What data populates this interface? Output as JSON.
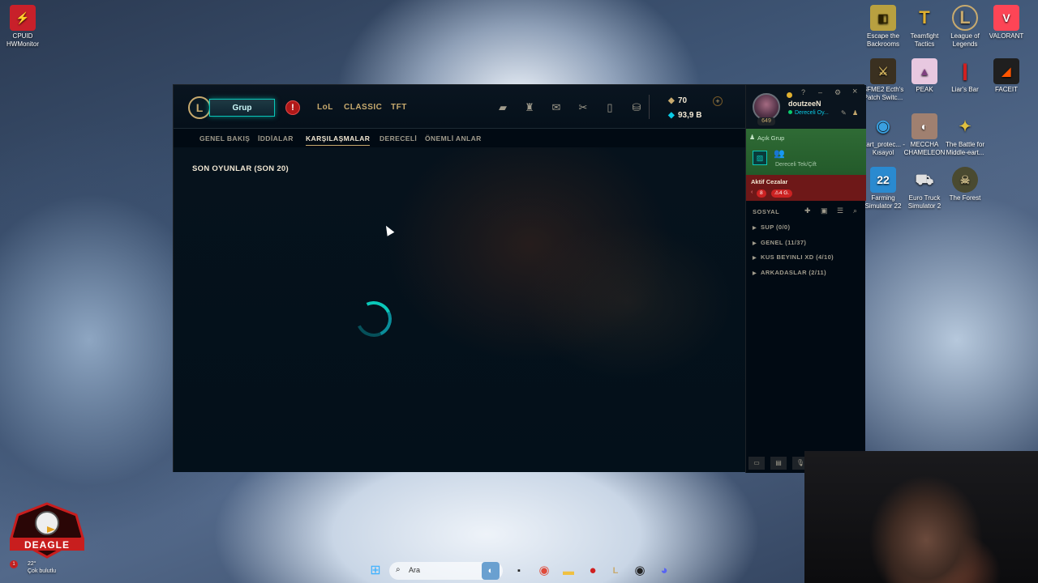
{
  "desktop": {
    "left_icons": [
      {
        "label": "CPUID HWMonitor"
      }
    ],
    "right_icons": [
      {
        "label": "Escape the Backrooms"
      },
      {
        "label": "Teamfight Tactics"
      },
      {
        "label": "League of Legends"
      },
      {
        "label": "VALORANT"
      },
      {
        "label": "BFME2 Ecth's Patch Switc..."
      },
      {
        "label": "PEAK"
      },
      {
        "label": "Liar's Bar"
      },
      {
        "label": "FACEIT"
      },
      {
        "label": "start_protec... - Kısayol"
      },
      {
        "label": "MECCHA CHAMELEON"
      },
      {
        "label": "The Battle for Middle-eart..."
      },
      {
        "label": "Farming Simulator 22"
      },
      {
        "label": "Euro Truck Simulator 2"
      },
      {
        "label": "The Forest"
      }
    ],
    "deagle_logo": "DEAGLE"
  },
  "client": {
    "play_button": "Grup",
    "alert": "!",
    "modes": [
      "LoL",
      "CLASSIC",
      "TFT"
    ],
    "currency": {
      "rp": "70",
      "be": "93,9 B",
      "plus": "+"
    },
    "profile": {
      "username": "doutzeeN",
      "status": "Dereceli Oy...",
      "level": "649"
    },
    "window_controls": {
      "help": "?",
      "minimize": "–",
      "settings": "⚙",
      "close": "×"
    },
    "subnav": [
      "GENEL BAKIŞ",
      "İDDİALAR",
      "KARŞILAŞMALAR",
      "DERECELİ",
      "ÖNEMLİ ANLAR"
    ],
    "section_title": "SON OYUNLAR (SON 20)",
    "party": {
      "label": "Açık Grup",
      "queue": "Dereceli Tek/Çift"
    },
    "penalty": {
      "title": "Aktif Cezalar",
      "count": "8",
      "duration": "4 G."
    },
    "social": {
      "title": "SOSYAL",
      "groups": [
        "SUP (0/0)",
        "GENEL (11/37)",
        "KUS BEYINLI XD (4/10)",
        "ARKADASLAR (2/11)"
      ]
    }
  },
  "taskbar": {
    "weather_temp": "22°",
    "weather_text": "Çok bulutlu",
    "weather_badge": "1",
    "search_placeholder": "Ara"
  }
}
